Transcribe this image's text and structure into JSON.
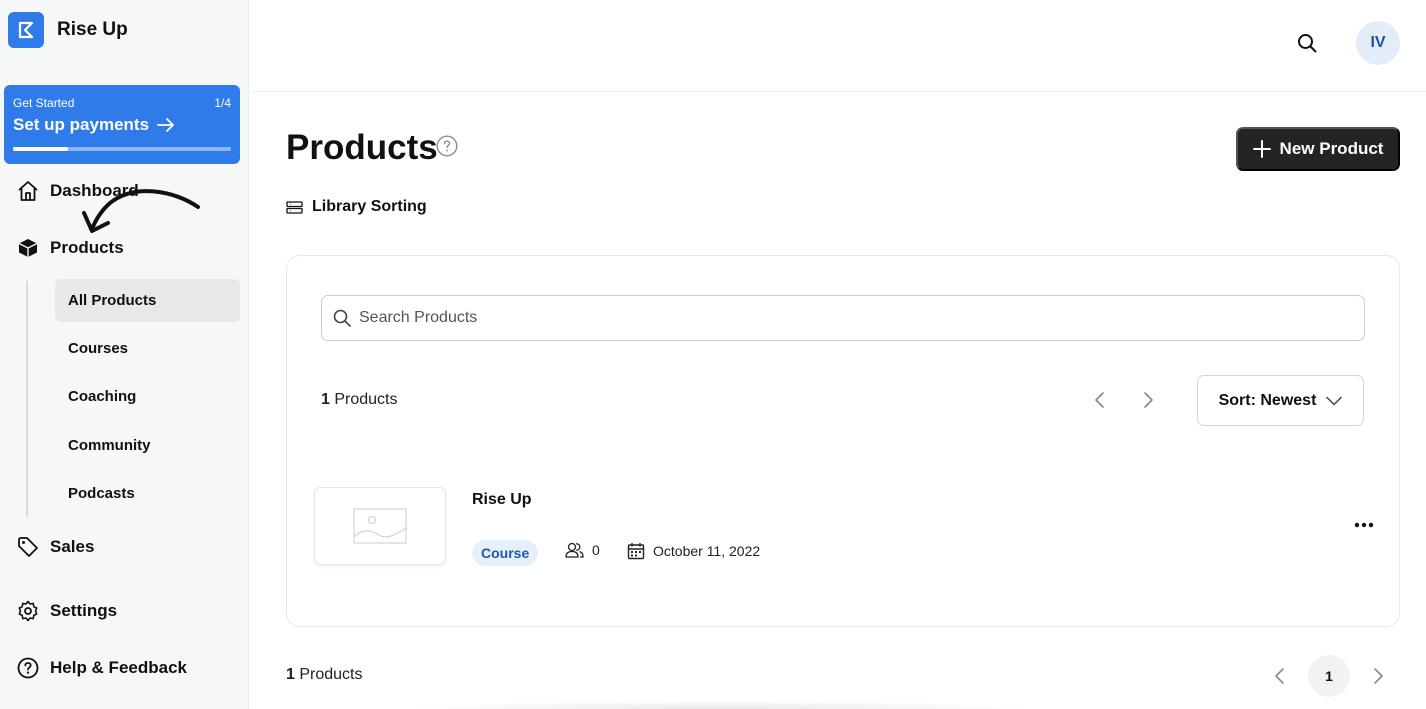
{
  "brand": {
    "name": "Rise Up",
    "logo_icon": "kajabi-logo-icon",
    "logo_color": "#2f7be9"
  },
  "get_started": {
    "label": "Get Started",
    "progress_text": "1/4",
    "title": "Set up payments",
    "progress": 0.25
  },
  "nav": {
    "dashboard": "Dashboard",
    "products": "Products",
    "sub_items": [
      "All Products",
      "Courses",
      "Coaching",
      "Community",
      "Podcasts"
    ],
    "sales": "Sales",
    "settings": "Settings",
    "help": "Help & Feedback"
  },
  "topbar": {
    "avatar_initials": "IV"
  },
  "main": {
    "title": "Products",
    "new_product_label": "New Product",
    "library_sorting_label": "Library Sorting",
    "search_placeholder": "Search Products",
    "count_number": "1",
    "count_label": "Products",
    "sort_label": "Sort: Newest"
  },
  "products": [
    {
      "name": "Rise Up",
      "type": "Course",
      "members": "0",
      "date": "October 11, 2022"
    }
  ],
  "footer": {
    "count_number": "1",
    "count_label": "Products",
    "current_page": "1"
  }
}
